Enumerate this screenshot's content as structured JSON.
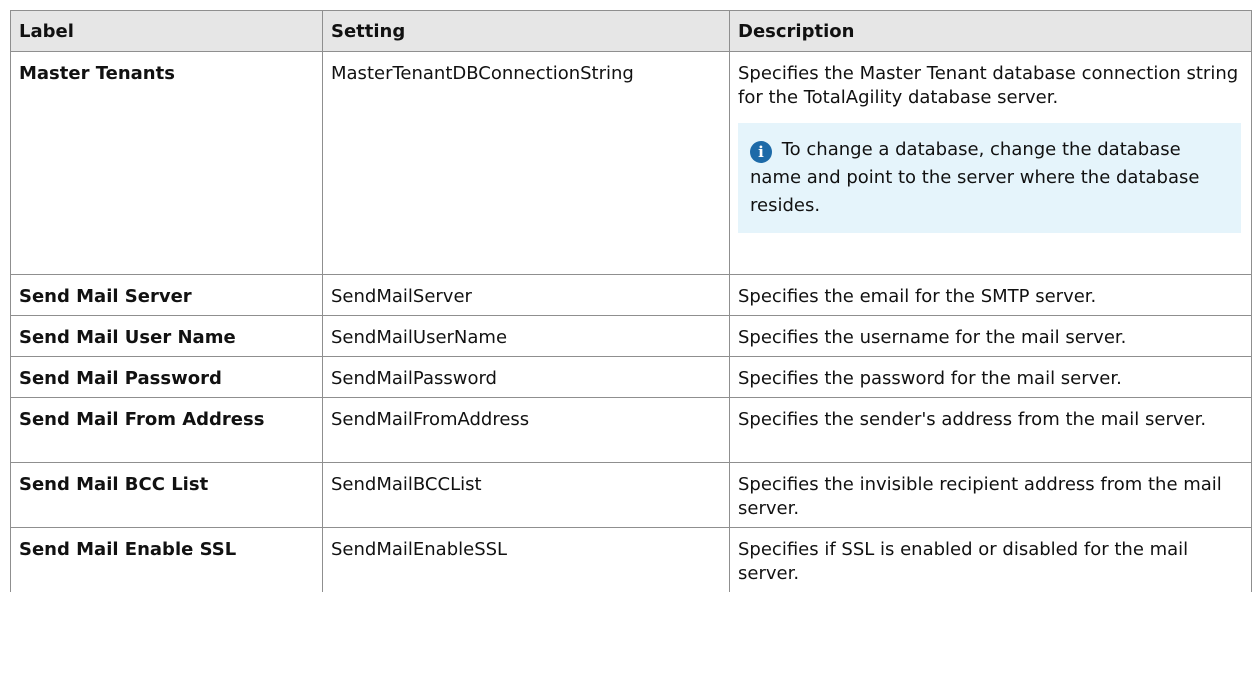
{
  "table": {
    "headers": {
      "label": "Label",
      "setting": "Setting",
      "description": "Description"
    },
    "rows": [
      {
        "label": "Master Tenants",
        "setting": "MasterTenantDBConnectionString",
        "description": "Specifies the Master Tenant database connection string for the TotalAgility database server.",
        "note": {
          "icon": "info-icon",
          "text": "To change a database, change the database name and point to the server where the database resides."
        }
      },
      {
        "label": "Send Mail Server",
        "setting": "SendMailServer",
        "description": "Specifies the email for the SMTP server."
      },
      {
        "label": "Send Mail User Name",
        "setting": "SendMailUserName",
        "description": "Specifies the username for the mail server."
      },
      {
        "label": "Send Mail Password",
        "setting": "SendMailPassword",
        "description": "Specifies the password for the mail server."
      },
      {
        "label": "Send Mail From Address",
        "setting": "SendMailFromAddress",
        "description": "Specifies the sender's address from the mail server."
      },
      {
        "label": "Send Mail BCC List",
        "setting": "SendMailBCCList",
        "description": "Specifies the invisible recipient address from the mail server."
      },
      {
        "label": "Send Mail Enable SSL",
        "setting": "SendMailEnableSSL",
        "description": "Specifies if SSL is enabled or disabled for the mail server."
      }
    ]
  },
  "colors": {
    "header_background": "#e6e6e6",
    "border": "#8f8f8f",
    "note_background": "#e5f4fb",
    "info_icon": "#1d6aa8"
  }
}
